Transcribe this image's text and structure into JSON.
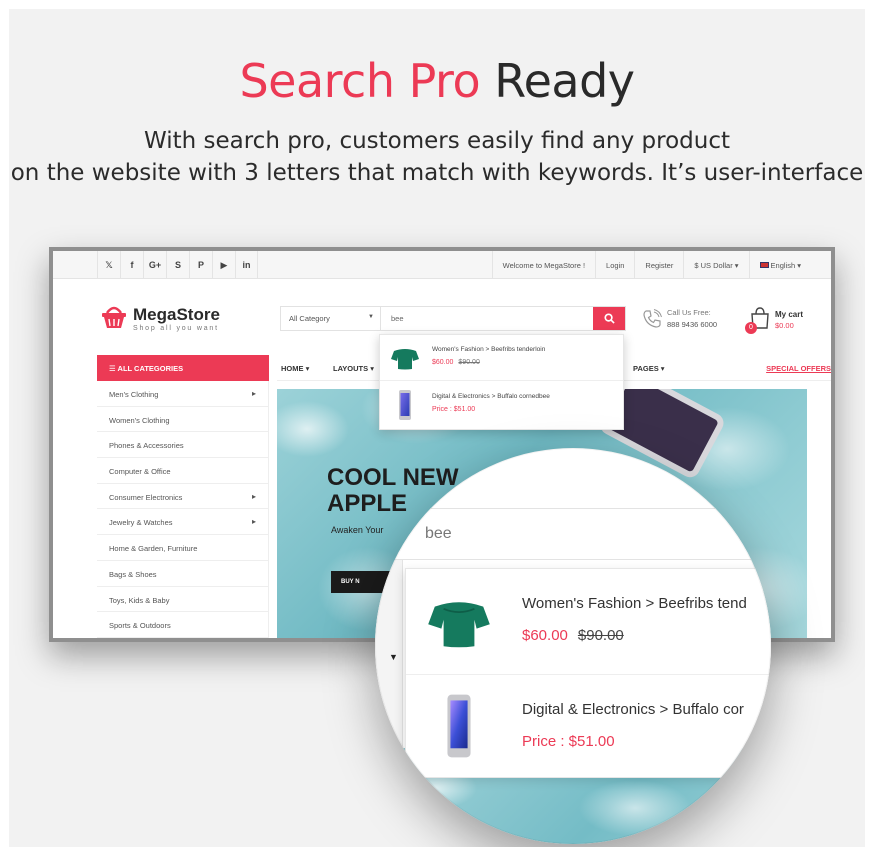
{
  "hero": {
    "title_accent": "Search Pro",
    "title_rest": "Ready",
    "desc_line1": "With search pro, customers easily find any product",
    "desc_line2": "on the website with 3 letters that match with keywords. It’s user-interface"
  },
  "topbar": {
    "social": [
      "twitter-icon",
      "facebook-icon",
      "google-plus-icon",
      "skype-icon",
      "pinterest-icon",
      "youtube-icon",
      "linkedin-icon"
    ],
    "social_glyphs": [
      "𝕏",
      "f",
      "G+",
      "S",
      "P",
      "▶",
      "in"
    ],
    "welcome": "Welcome to MegaStore !",
    "login": "Login",
    "register": "Register",
    "currency": "$ US Dollar ▾",
    "language": "English ▾"
  },
  "header": {
    "logo_name": "MegaStore",
    "logo_tagline": "Shop all you want",
    "category_select": "All Category",
    "search_value": "bee",
    "call_label": "Call Us Free:",
    "call_number": "888 9436 6000",
    "cart_label": "My cart",
    "cart_total": "$0.00",
    "cart_count": "0"
  },
  "nav": {
    "all_categories": "ALL CATEGORIES",
    "items": [
      "HOME ▾",
      "LAYOUTS ▾",
      "PAGES ▾"
    ],
    "special": "SPECIAL OFFERS"
  },
  "categories": [
    "Men's Clothing",
    "Women's Clothing",
    "Phones & Accessories",
    "Computer & Office",
    "Consumer Electronics",
    "Jewelry & Watches",
    "Home & Garden, Furniture",
    "Bags & Shoes",
    "Toys, Kids & Baby",
    "Sports & Outdoors"
  ],
  "banner": {
    "headline_line1": "COOL NEW",
    "headline_line2": "APPLE",
    "subtext": "Awaken Your",
    "button": "BUY N"
  },
  "results": [
    {
      "path": "Women's Fashion > Beefribs tenderloin",
      "price": "$60.00",
      "old_price": "$90.00"
    },
    {
      "path": "Digital & Electronics > Buffalo cornedbee",
      "price": "Price : $51.00",
      "old_price": ""
    }
  ],
  "magnifier": {
    "search_value": "bee",
    "results": [
      {
        "path": "Women's Fashion > Beefribs tend",
        "price": "$60.00",
        "old_price": "$90.00"
      },
      {
        "path": "Digital & Electronics > Buffalo cor",
        "price": "Price : $51.00"
      }
    ]
  },
  "colors": {
    "accent": "#ec3a55",
    "text": "#2a2a2a",
    "background": "#f2f2f2"
  }
}
